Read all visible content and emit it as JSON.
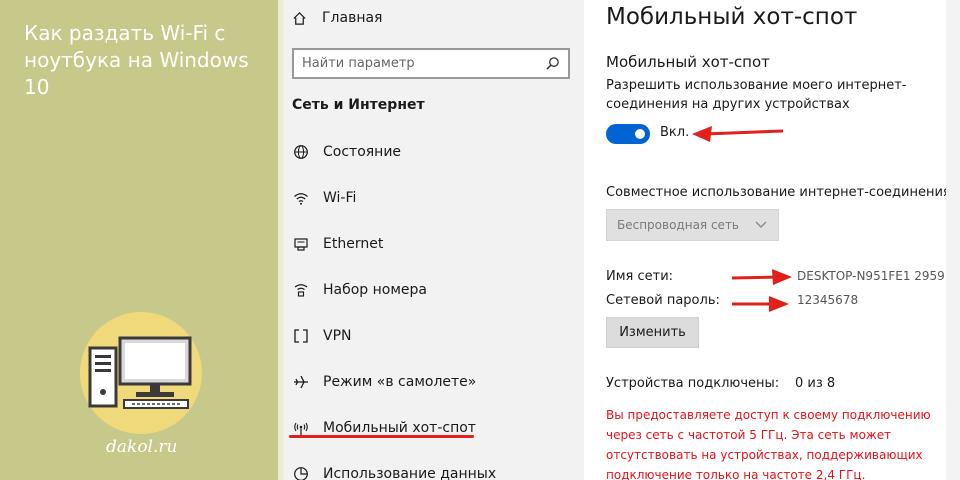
{
  "promo": {
    "title": "Как раздать Wi-Fi с ноутбука на Windows 10",
    "site": "dakol.ru"
  },
  "nav": {
    "home_label": "Главная",
    "search_placeholder": "Найти параметр",
    "section_title": "Сеть и Интернет",
    "items": [
      {
        "label": "Состояние",
        "icon": "globe-icon"
      },
      {
        "label": "Wi-Fi",
        "icon": "wifi-icon"
      },
      {
        "label": "Ethernet",
        "icon": "ethernet-icon"
      },
      {
        "label": "Набор номера",
        "icon": "dialup-icon"
      },
      {
        "label": "VPN",
        "icon": "vpn-icon"
      },
      {
        "label": "Режим «в самолете»",
        "icon": "airplane-icon"
      },
      {
        "label": "Мобильный хот-спот",
        "icon": "hotspot-icon"
      },
      {
        "label": "Использование данных",
        "icon": "data-usage-icon"
      }
    ]
  },
  "content": {
    "page_title": "Мобильный хот-спот",
    "sub_title": "Мобильный хот-спот",
    "description": "Разрешить использование моего интернет-соединения на других устройствах",
    "toggle_label": "Вкл.",
    "share_label": "Совместное использование интернет-соединения",
    "share_select": "Беспроводная сеть",
    "network_name_label": "Имя сети:",
    "network_name_value": "DESKTOP-N951FE1 2959",
    "password_label": "Сетевой пароль:",
    "password_value": "12345678",
    "edit_button": "Изменить",
    "devices_label": "Устройства подключены:",
    "devices_value": "0 из 8",
    "warning": "Вы предоставляете доступ к своему подключению через сеть с частотой 5 ГГц. Эта сеть может отсутствовать на устройствах, поддерживающих подключение только на частоте 2,4 ГГц."
  },
  "colors": {
    "promo_bg": "#c7c98a",
    "accent": "#0063d1",
    "annotation_red": "#e0201b",
    "warning_red": "#e8101a"
  }
}
